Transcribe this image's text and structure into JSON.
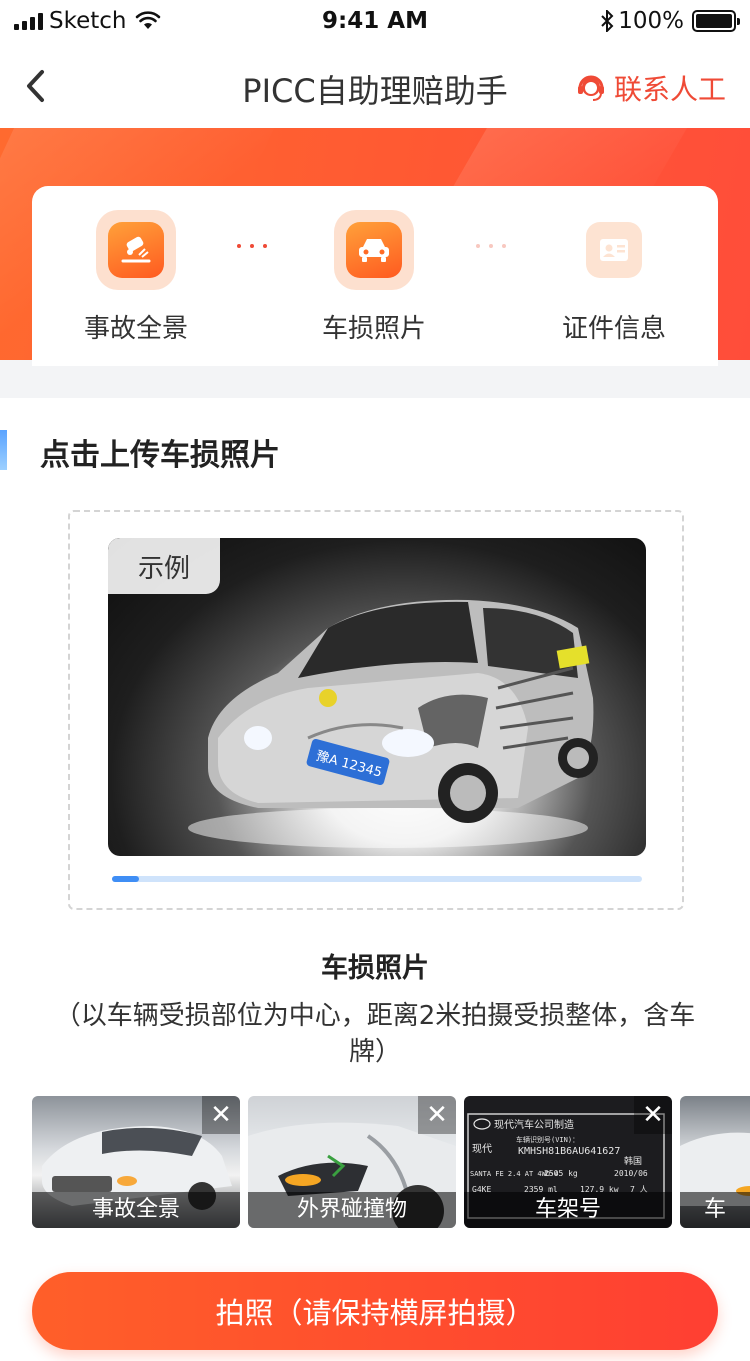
{
  "status_bar": {
    "carrier": "Sketch",
    "time": "9:41 AM",
    "battery_percent": "100%",
    "battery_level": 1.0
  },
  "nav": {
    "title": "PICC自助理赔助手",
    "contact_label": "联系人工",
    "accent_color": "#ef4a36"
  },
  "steps": [
    {
      "label": "事故全景",
      "icon": "accident-icon",
      "active": true
    },
    {
      "label": "车损照片",
      "icon": "car-icon",
      "active": true
    },
    {
      "label": "证件信息",
      "icon": "id-card-icon",
      "active": false
    }
  ],
  "upload": {
    "section_title": "点击上传车损照片",
    "sample_tag": "示例",
    "plate_text": "豫A 12345",
    "progress": 0.05,
    "caption": "车损照片",
    "description": "（以车辆受损部位为中心，距离2米拍摄受损整体，含车牌）"
  },
  "thumbnails": [
    {
      "label": "事故全景",
      "close": "✕"
    },
    {
      "label": "外界碰撞物",
      "close": "✕"
    },
    {
      "label": "车架号",
      "close": "✕"
    },
    {
      "label": "车",
      "close": ""
    }
  ],
  "vin_plate": {
    "brand": "现代汽车公司制造",
    "vin_label": "车辆识别号(VIN)：",
    "vin": "KMHSH81B6AU641627",
    "maker": "现代",
    "country": "韩国",
    "model": "SANTA FE 2.4 AT 4WD-4",
    "mass": "2505 kg",
    "date": "2010/06",
    "engine": "G4KE",
    "displacement": "2359 ml",
    "power": "127.9 kw",
    "seats": "7 人"
  },
  "cta": {
    "label": "拍照（请保持横屏拍摄）"
  }
}
